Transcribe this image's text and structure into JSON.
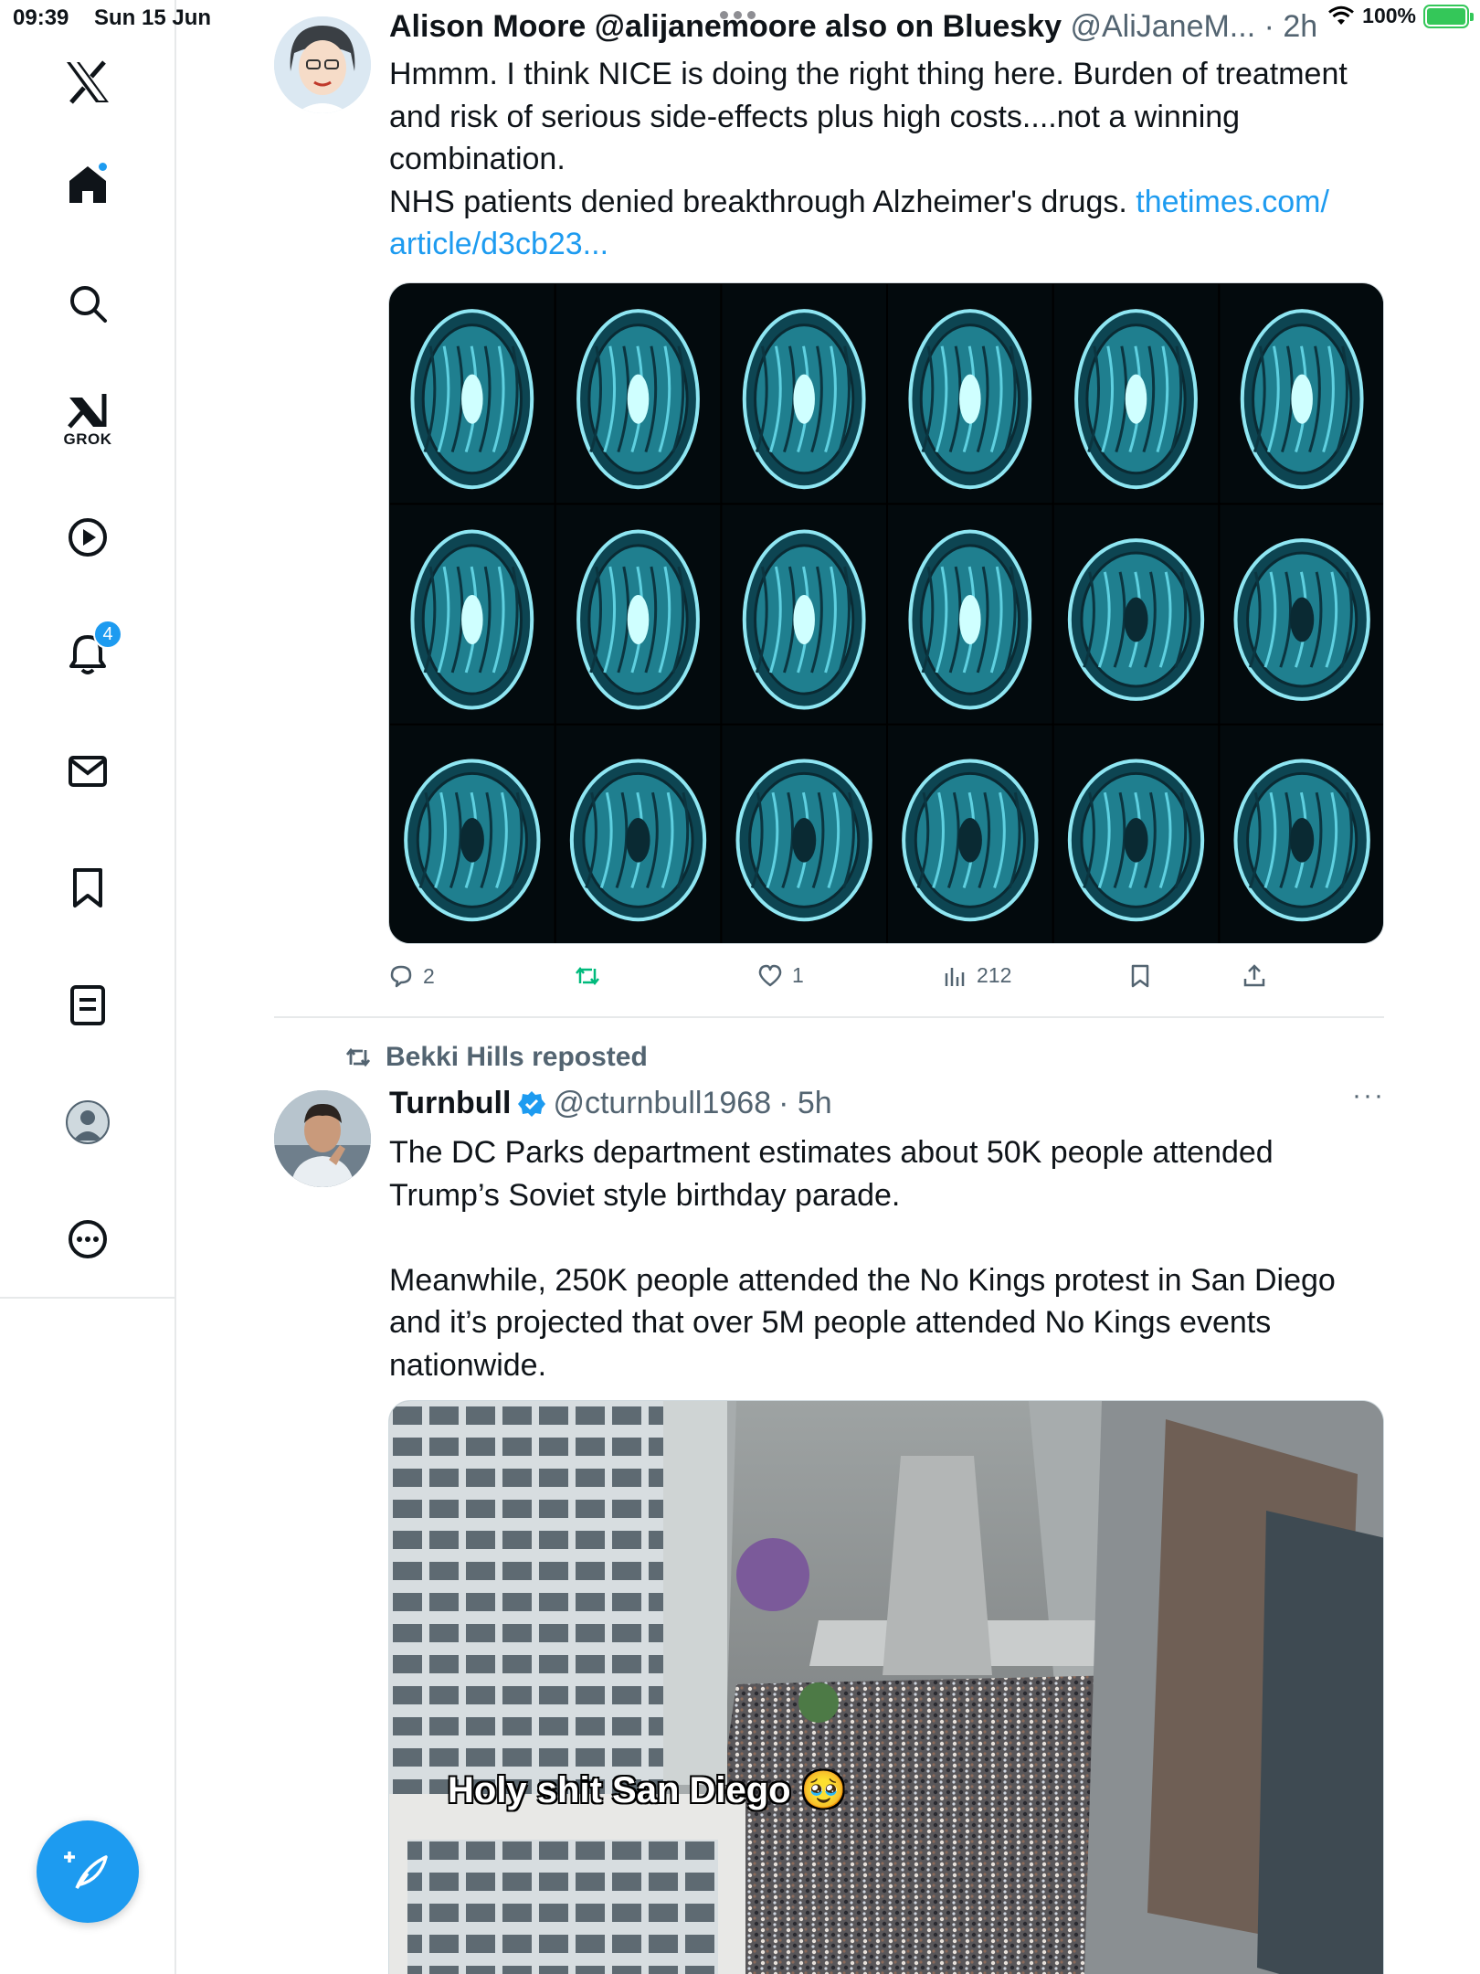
{
  "status_bar": {
    "time": "09:39",
    "date": "Sun 15 Jun",
    "battery": "100%"
  },
  "sidebar": {
    "items": [
      {
        "icon": "x-logo-icon"
      },
      {
        "icon": "home-icon"
      },
      {
        "icon": "search-icon"
      },
      {
        "icon": "grok-icon",
        "label": "GROK"
      },
      {
        "icon": "video-icon"
      },
      {
        "icon": "bell-icon",
        "badge": "4"
      },
      {
        "icon": "mail-icon"
      },
      {
        "icon": "bookmark-icon"
      },
      {
        "icon": "lists-icon"
      },
      {
        "icon": "profile-icon"
      },
      {
        "icon": "more-icon"
      }
    ],
    "compose_icon": "compose-icon"
  },
  "tweets": [
    {
      "name": "Alison Moore @alijanemoore also on Bluesky",
      "handle": "@AliJaneM...",
      "time": "· 2h",
      "text_lines": [
        "Hmmm. I think NICE is doing the right thing here. Burden of treatment",
        "and risk of serious side-effects plus high costs....not a winning",
        "combination."
      ],
      "text_line4": "NHS patients denied breakthrough Alzheimer's drugs. ",
      "link_part1": "thetimes.com/",
      "link_part2": "article/d3cb23...",
      "actions": {
        "replies": "2",
        "reposts": "",
        "likes": "1",
        "views": "212"
      }
    },
    {
      "repost_by": "Bekki Hills reposted",
      "name": "Turnbull",
      "handle": "@cturnbull1968",
      "time": "· 5h",
      "text_lines": [
        "The DC Parks department estimates about 50K people attended",
        "Trump’s Soviet style birthday parade.",
        "",
        "Meanwhile, 250K people attended the No Kings protest in San Diego",
        "and it’s projected that over 5M people attended No Kings events",
        "nationwide."
      ],
      "media_caption": "Holy shit San Diego 🥹"
    }
  ],
  "colors": {
    "accent": "#1d9bf0",
    "text": "#0f1419",
    "muted": "#536471",
    "repost_green": "#00ba7c"
  }
}
